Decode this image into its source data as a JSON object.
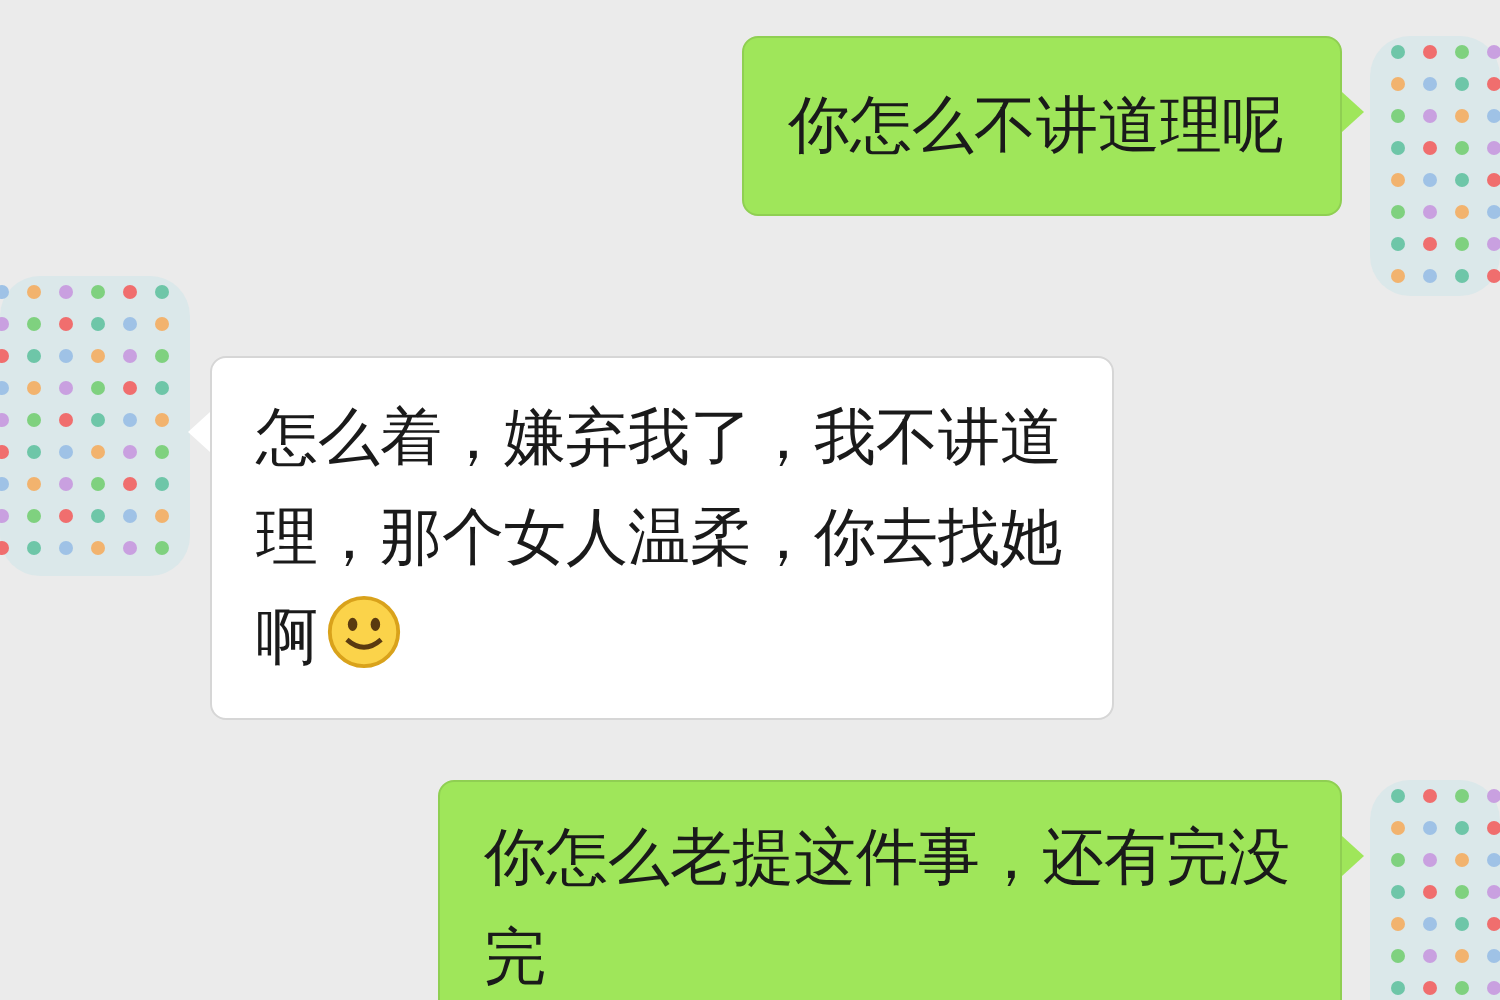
{
  "messages": [
    {
      "kind": "sent",
      "text": "你怎么不讲道理呢",
      "emoji": false
    },
    {
      "kind": "received",
      "text": "怎么着，嫌弃我了，我不讲道理，那个女人温柔，你去找她啊",
      "emoji": true
    },
    {
      "kind": "sent",
      "text": "你怎么老提这件事，还有完没完",
      "emoji": false
    }
  ]
}
